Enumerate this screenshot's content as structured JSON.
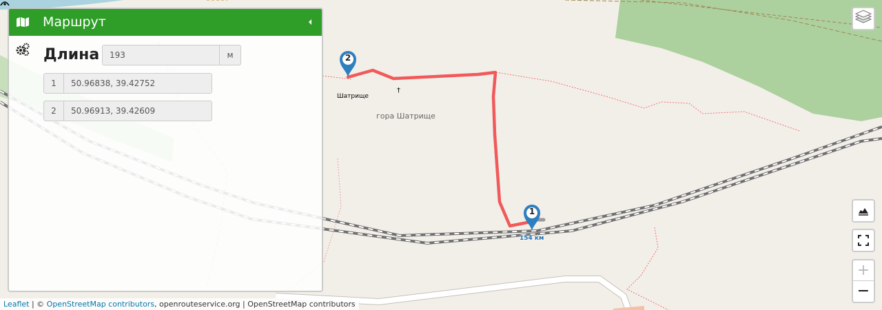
{
  "panel": {
    "title": "Маршрут",
    "length_label": "Длина",
    "length_value": "193",
    "length_unit": "м",
    "points": [
      {
        "index": "1",
        "coords": "50.96838, 39.42752"
      },
      {
        "index": "2",
        "coords": "50.96913, 39.42609"
      }
    ]
  },
  "map": {
    "peak_name": "Шатрище",
    "mountain_name": "гора Шатрище",
    "km_marker": "154 км",
    "cross_glyph": "†",
    "markers": [
      {
        "number": "1"
      },
      {
        "number": "2"
      }
    ],
    "route_color": "#f05a5a",
    "forest_color": "#add19e",
    "marker_color": "#2e7fbf"
  },
  "controls": {
    "zoom_in": "+",
    "zoom_out": "−"
  },
  "attribution": {
    "leaflet": "Leaflet",
    "separator": " | © ",
    "osm": "OpenStreetMap contributors",
    "rest": ", openrouteservice.org | OpenStreetMap contributors"
  },
  "icons": [
    "map-icon",
    "collapse-icon",
    "gear-icon",
    "layers-icon",
    "elevation-icon",
    "fullscreen-icon",
    "peak-icon",
    "cross-icon",
    "route-marker-icon"
  ]
}
